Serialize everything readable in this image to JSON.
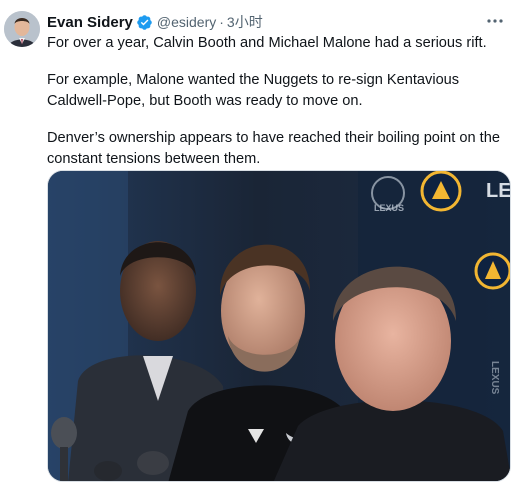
{
  "tweet": {
    "author_name": "Evan Sidery",
    "handle": "@esidery",
    "separator": "·",
    "time": "3小时",
    "paragraphs": [
      "For over a year, Calvin Booth and Michael Malone had a serious rift.",
      "For example, Malone wanted the Nuggets to re-sign Kentavious Caldwell-Pope, but Booth was ready to move on.",
      "Denver’s ownership appears to have reached their boiling point on the constant tensions between them."
    ]
  },
  "media": {
    "backdrop_text_top": "LEX",
    "backdrop_text_right": "LEXUS",
    "backdrop_brand_left": "LEXUS"
  },
  "icons": {
    "verified": "verified-badge-icon",
    "more": "more-options-icon"
  },
  "colors": {
    "text_primary": "#0f1419",
    "text_secondary": "#536471",
    "verified_blue": "#1d9bf0"
  }
}
